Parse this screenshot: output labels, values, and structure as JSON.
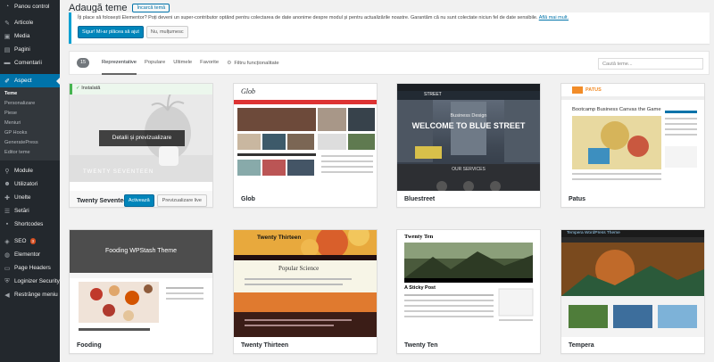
{
  "sidebar": {
    "items": [
      {
        "label": "Panou control",
        "icon": "dashboard-icon"
      },
      {
        "label": "Articole",
        "icon": "pin-icon"
      },
      {
        "label": "Media",
        "icon": "media-icon"
      },
      {
        "label": "Pagini",
        "icon": "page-icon"
      },
      {
        "label": "Comentarii",
        "icon": "comment-icon"
      },
      {
        "label": "Aspect",
        "icon": "brush-icon"
      }
    ],
    "submenu": [
      "Teme",
      "Personalizare",
      "Piese",
      "Meniuri",
      "GP Hooks",
      "GeneratePress",
      "Editor teme"
    ],
    "items2": [
      {
        "label": "Module",
        "icon": "plugin-icon"
      },
      {
        "label": "Utilizatori",
        "icon": "users-icon"
      },
      {
        "label": "Unelte",
        "icon": "tools-icon"
      },
      {
        "label": "Setări",
        "icon": "settings-icon"
      },
      {
        "label": "Shortcodes",
        "icon": "shortcode-icon"
      },
      {
        "label": "SEO",
        "icon": "seo-icon",
        "badge": "3"
      },
      {
        "label": "Elementor",
        "icon": "elementor-icon"
      },
      {
        "label": "Page Headers",
        "icon": "page-headers-icon"
      },
      {
        "label": "Loginizer Security",
        "icon": "shield-icon"
      },
      {
        "label": "Restrânge meniu",
        "icon": "collapse-icon"
      }
    ]
  },
  "header": {
    "title": "Adaugă teme",
    "upload_label": "Încarcă temă"
  },
  "notice": {
    "text": "Îți place să folosești Elementor? Poți deveni un super-contributor optând pentru colectarea de date anonime despre modul și pentru actualizările noastre. Garantăm că nu sunt colectate niciun fel de date sensibile.",
    "link": "Află mai mult.",
    "accept_label": "Sigur! Mi-ar plăcea să ajut",
    "decline_label": "Nu, mulțumesc"
  },
  "filter": {
    "count": "15",
    "tabs": [
      "Reprezentative",
      "Populare",
      "Ultimele",
      "Favorite"
    ],
    "feature_filter": "Filtru funcționalitate",
    "search_placeholder": "Caută teme..."
  },
  "themes": [
    {
      "name": "Twenty Seventeen",
      "installed": "Instalată",
      "details": "Detalii și previzualizare",
      "activate": "Activează",
      "preview": "Previzualizare live",
      "logo": "TWENTY SEVENTEEN"
    },
    {
      "name": "Glob",
      "logo": "Glob"
    },
    {
      "name": "Bluestreet",
      "hero_sub": "Business Design",
      "hero_title": "WELCOME TO BLUE STREET",
      "services": "OUR SERVICES",
      "logo": "STREET"
    },
    {
      "name": "Patus",
      "logo": "PATUS",
      "heading": "Bootcamp Business Canvas the Game"
    },
    {
      "name": "Fooding",
      "hero": "Fooding WPStash Theme"
    },
    {
      "name": "Twenty Thirteen",
      "heading": "Popular Science"
    },
    {
      "name": "Twenty Ten",
      "site": "Twenty Ten",
      "post": "A Sticky Post"
    },
    {
      "name": "Tempera",
      "site": "Tempera WordPress Theme"
    }
  ],
  "colors": {
    "accent": "#0073aa",
    "sidebar": "#23282d",
    "installed": "#46b450"
  }
}
